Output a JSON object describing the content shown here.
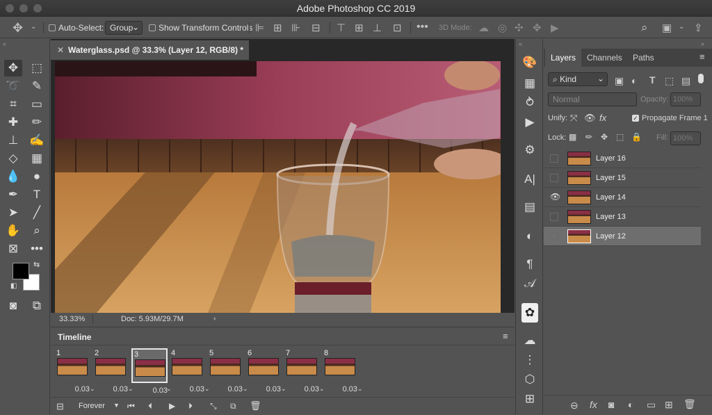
{
  "window": {
    "title": "Adobe Photoshop CC 2019"
  },
  "options_bar": {
    "auto_select_label": "Auto-Select:",
    "auto_select_value": "Group",
    "show_transform_label": "Show Transform Controls",
    "mode_3d_label": "3D Mode:"
  },
  "document": {
    "tab_title": "Waterglass.psd @ 33.3% (Layer 12, RGB/8) *",
    "zoom": "33.33%",
    "doc_info": "Doc: 5.93M/29.7M"
  },
  "timeline": {
    "title": "Timeline",
    "loop_value": "Forever",
    "frames": [
      {
        "number": "1",
        "delay": "0.03"
      },
      {
        "number": "2",
        "delay": "0.03"
      },
      {
        "number": "3",
        "delay": "0.03",
        "selected": true
      },
      {
        "number": "4",
        "delay": "0.03"
      },
      {
        "number": "5",
        "delay": "0.03"
      },
      {
        "number": "6",
        "delay": "0.03"
      },
      {
        "number": "7",
        "delay": "0.03"
      },
      {
        "number": "8",
        "delay": "0.03"
      }
    ]
  },
  "layers_panel": {
    "tabs": [
      "Layers",
      "Channels",
      "Paths"
    ],
    "filter_kind": "Kind",
    "blend_mode": "Normal",
    "opacity_label": "Opacity:",
    "opacity_value": "100%",
    "unify_label": "Unify:",
    "propagate_label": "Propagate Frame 1",
    "lock_label": "Lock:",
    "fill_label": "Fill:",
    "fill_value": "100%",
    "layers": [
      {
        "name": "Layer 16",
        "visible": false
      },
      {
        "name": "Layer 15",
        "visible": false
      },
      {
        "name": "Layer 14",
        "visible": true
      },
      {
        "name": "Layer 13",
        "visible": false
      },
      {
        "name": "Layer 12",
        "visible": false,
        "selected": true
      }
    ]
  },
  "colors": {
    "accent": "#535353",
    "selected_layer": "#6e6e6e",
    "panel_bg": "#535353"
  }
}
